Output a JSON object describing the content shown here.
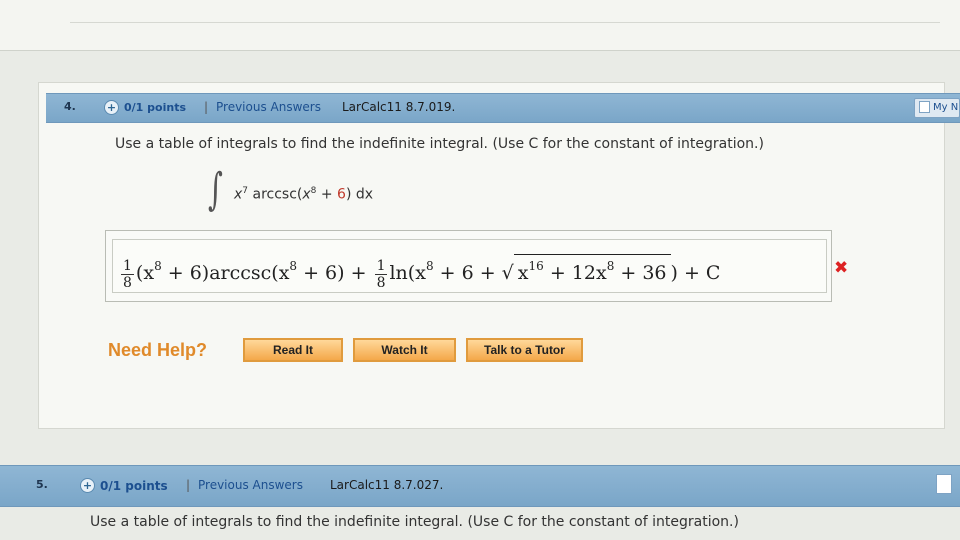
{
  "question4": {
    "number": "4.",
    "points_icon": "+",
    "points": "0/1 points",
    "separator": "|",
    "previous": "Previous Answers",
    "reference": "LarCalc11 8.7.019.",
    "my_notes": "My N",
    "instruction": "Use a table of integrals to find the indefinite integral. (Use C for the constant of integration.)",
    "integral": {
      "sign": "∫",
      "var": "x",
      "exp1": "7",
      "func": "arccsc(",
      "var2": "x",
      "exp2": "8",
      "plus": " + ",
      "const": "6",
      "tail": ") dx"
    },
    "answer": {
      "frac1_num": "1",
      "frac1_den": "8",
      "part1": "(x",
      "exp_a": "8",
      "part2": " + 6)arccsc(x",
      "exp_b": "8",
      "part3": " + 6) + ",
      "frac2_num": "1",
      "frac2_den": "8",
      "part4": "ln(x",
      "exp_c": "8",
      "part5": " + 6 + ",
      "sqrt_sym": "√",
      "sqrt_a": "x",
      "exp_d": "16",
      "sqrt_b": " + 12x",
      "exp_e": "8",
      "sqrt_c": " + 36",
      "part6": ") + C"
    },
    "status_mark": "✖",
    "need_help": "Need Help?",
    "buttons": {
      "read": "Read It",
      "watch": "Watch It",
      "tutor": "Talk to a Tutor"
    }
  },
  "question5": {
    "number": "5.",
    "points_icon": "+",
    "points": "0/1 points",
    "separator": "|",
    "previous": "Previous Answers",
    "reference": "LarCalc11 8.7.027.",
    "instruction": "Use a table of integrals to find the indefinite integral. (Use C for the constant of integration.)"
  }
}
